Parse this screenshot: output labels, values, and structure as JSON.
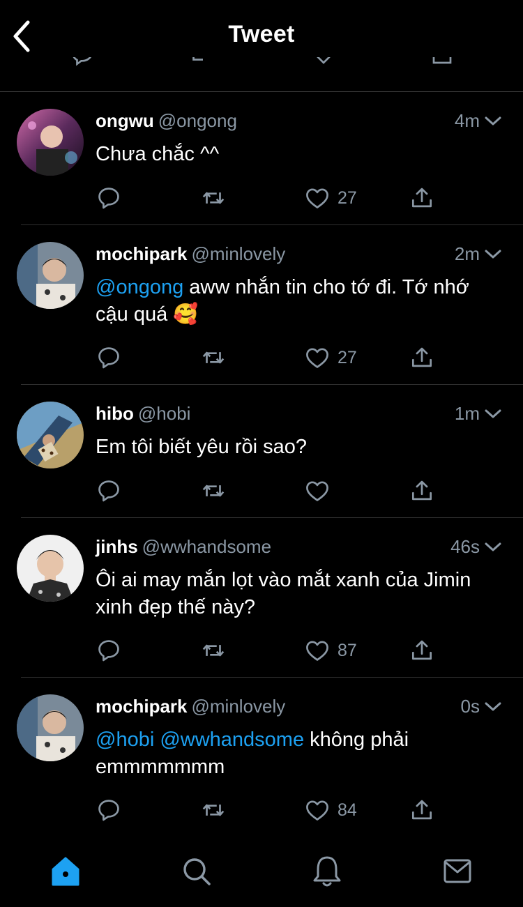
{
  "header": {
    "title": "Tweet"
  },
  "colors": {
    "accent": "#1da1f2",
    "muted": "#8b98a5",
    "background": "#000000",
    "divider": "#2f2f2f"
  },
  "tweets": [
    {
      "name": "ongwu",
      "handle": "@ongong",
      "time": "4m",
      "text_parts": [
        {
          "text": "Chưa chắc ^^",
          "mention": false
        }
      ],
      "likes": "27"
    },
    {
      "name": "mochipark",
      "handle": "@minlovely",
      "time": "2m",
      "text_parts": [
        {
          "text": "@ongong",
          "mention": true
        },
        {
          "text": " aww nhắn tin cho tớ đi. Tớ nhớ cậu quá 🥰",
          "mention": false
        }
      ],
      "likes": "27"
    },
    {
      "name": "hibo",
      "handle": "@hobi",
      "time": "1m",
      "text_parts": [
        {
          "text": "Em tôi biết yêu rồi sao?",
          "mention": false
        }
      ],
      "likes": ""
    },
    {
      "name": "jinhs",
      "handle": "@wwhandsome",
      "time": "46s",
      "text_parts": [
        {
          "text": "Ôi ai may mắn lọt vào mắt xanh của Jimin xinh đẹp thế này?",
          "mention": false
        }
      ],
      "likes": "87"
    },
    {
      "name": "mochipark",
      "handle": "@minlovely",
      "time": "0s",
      "text_parts": [
        {
          "text": "@hobi",
          "mention": true
        },
        {
          "text": " ",
          "mention": false
        },
        {
          "text": "@wwhandsome",
          "mention": true
        },
        {
          "text": " không phải emmmmmmm",
          "mention": false
        }
      ],
      "likes": "84"
    }
  ],
  "tabbar": {
    "active": "home",
    "items": [
      "home-icon",
      "search-icon",
      "bell-icon",
      "mail-icon"
    ]
  }
}
